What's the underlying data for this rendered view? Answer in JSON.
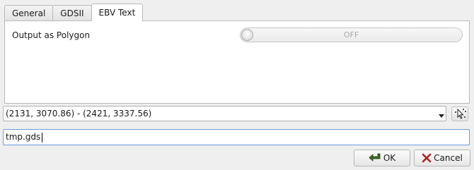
{
  "tabs": [
    {
      "label": "General",
      "active": false
    },
    {
      "label": "GDSII",
      "active": false
    },
    {
      "label": "EBV Text",
      "active": true
    }
  ],
  "options": {
    "output_as_polygon": {
      "label": "Output as Polygon",
      "state": "OFF",
      "on": false
    }
  },
  "region_select": {
    "value": "(2131, 3070.86) - (2421, 3337.56)"
  },
  "filename_input": {
    "value": "tmp.gds"
  },
  "buttons": {
    "ok": {
      "label": "OK",
      "icon": "ok-icon"
    },
    "cancel": {
      "label": "Cancel",
      "icon": "cancel-icon"
    }
  },
  "colors": {
    "focus_border": "#6aa0d6",
    "ok_icon": "#3d6b1f",
    "cancel_icon": "#b02020"
  }
}
